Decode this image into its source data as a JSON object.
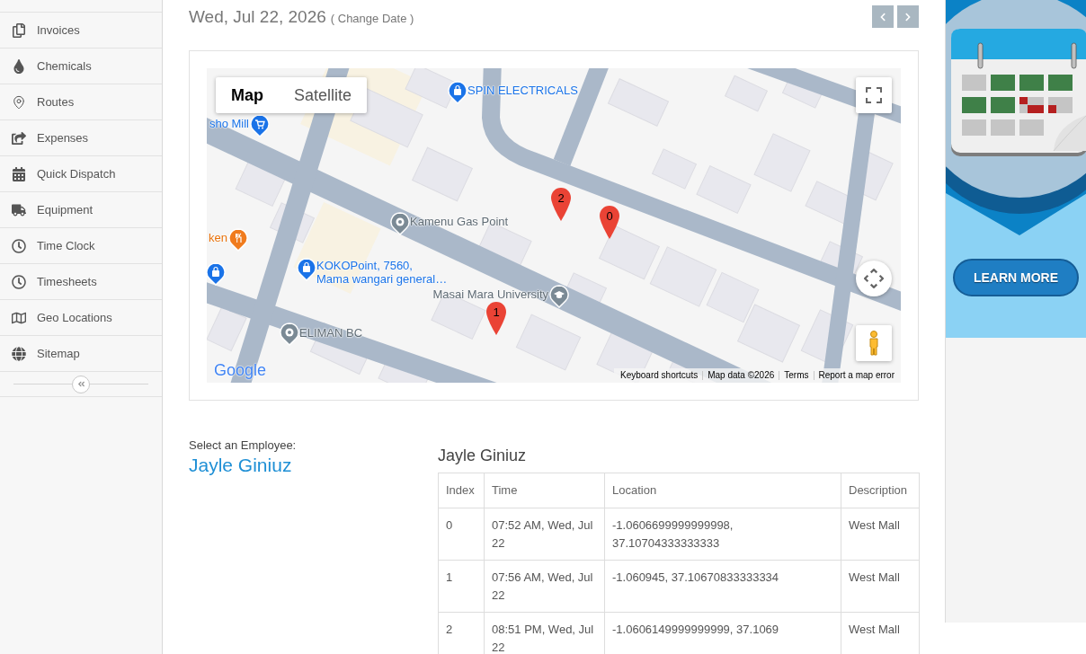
{
  "sidebar": {
    "items": [
      {
        "label": "Invoices"
      },
      {
        "label": "Chemicals"
      },
      {
        "label": "Routes"
      },
      {
        "label": "Expenses"
      },
      {
        "label": "Quick Dispatch"
      },
      {
        "label": "Equipment"
      },
      {
        "label": "Time Clock"
      },
      {
        "label": "Timesheets"
      },
      {
        "label": "Geo Locations"
      },
      {
        "label": "Sitemap"
      }
    ]
  },
  "header": {
    "date": "Wed, Jul 22, 2026",
    "change_date": "( Change Date )"
  },
  "map": {
    "view_types": [
      {
        "label": "Map",
        "selected": true
      },
      {
        "label": "Satellite",
        "selected": false
      }
    ],
    "places": [
      {
        "kind": "shop",
        "label": "SPIN ELECTRICALS"
      },
      {
        "kind": "cart",
        "label": "sho Mill"
      },
      {
        "kind": "place",
        "label": "Kamenu Gas Point"
      },
      {
        "kind": "food",
        "label": "ken"
      },
      {
        "kind": "shop",
        "label": "KOKOPoint, 7560,\nMama wangari general…"
      },
      {
        "kind": "shop"
      },
      {
        "kind": "school",
        "label": "Masai Mara University"
      },
      {
        "kind": "place",
        "label": "ELIMAN BC"
      }
    ],
    "markers": [
      {
        "label": "2"
      },
      {
        "label": "0"
      },
      {
        "label": "1"
      }
    ],
    "logo": "Google",
    "attribution": [
      "Keyboard shortcuts",
      "Map data ©2026",
      "Terms",
      "Report a map error"
    ]
  },
  "employee": {
    "prompt": "Select an Employee:",
    "name": "Jayle Giniuz"
  },
  "table": {
    "title": "Jayle Giniuz",
    "columns": [
      "Index",
      "Time",
      "Location",
      "Description"
    ],
    "rows": [
      [
        "0",
        "07:52 AM, Wed, Jul 22",
        "-1.0606699999999998, 37.10704333333333",
        "West Mall"
      ],
      [
        "1",
        "07:56 AM, Wed, Jul 22",
        "-1.060945, 37.10670833333334",
        "West Mall"
      ],
      [
        "2",
        "08:51 PM, Wed, Jul 22",
        "-1.0606149999999999, 37.1069",
        "West Mall"
      ]
    ]
  },
  "ad": {
    "button": "LEARN MORE"
  }
}
